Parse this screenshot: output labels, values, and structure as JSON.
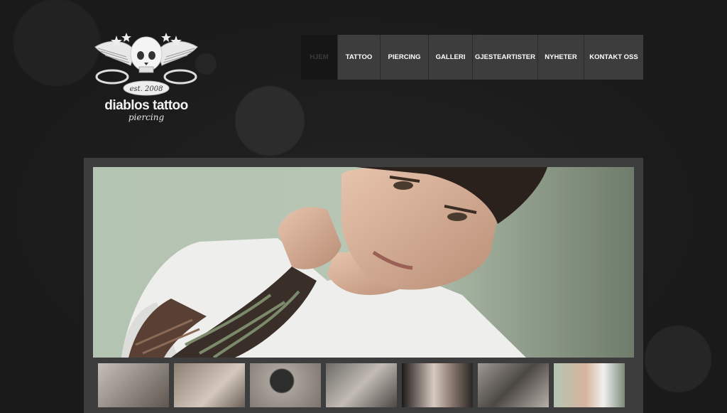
{
  "brand": {
    "name": "diablos tattoo",
    "sub": "piercing",
    "established": "est. 2008",
    "logo_icon": "winged-skull-icon"
  },
  "nav": {
    "items": [
      {
        "label": "HJEM",
        "active": true
      },
      {
        "label": "TATTOO",
        "active": false
      },
      {
        "label": "PIERCING",
        "active": false
      },
      {
        "label": "GALLERI",
        "active": false
      },
      {
        "label": "GJESTEARTISTER",
        "active": false
      },
      {
        "label": "NYHETER",
        "active": false
      },
      {
        "label": "KONTAKT OSS",
        "active": false
      }
    ]
  },
  "colors": {
    "background": "#1c1c1c",
    "nav_bg": "#3d3d3d",
    "nav_active": "#161616",
    "gallery_frame": "#3d3d3d"
  },
  "gallery": {
    "thumbnail_count": 7
  }
}
